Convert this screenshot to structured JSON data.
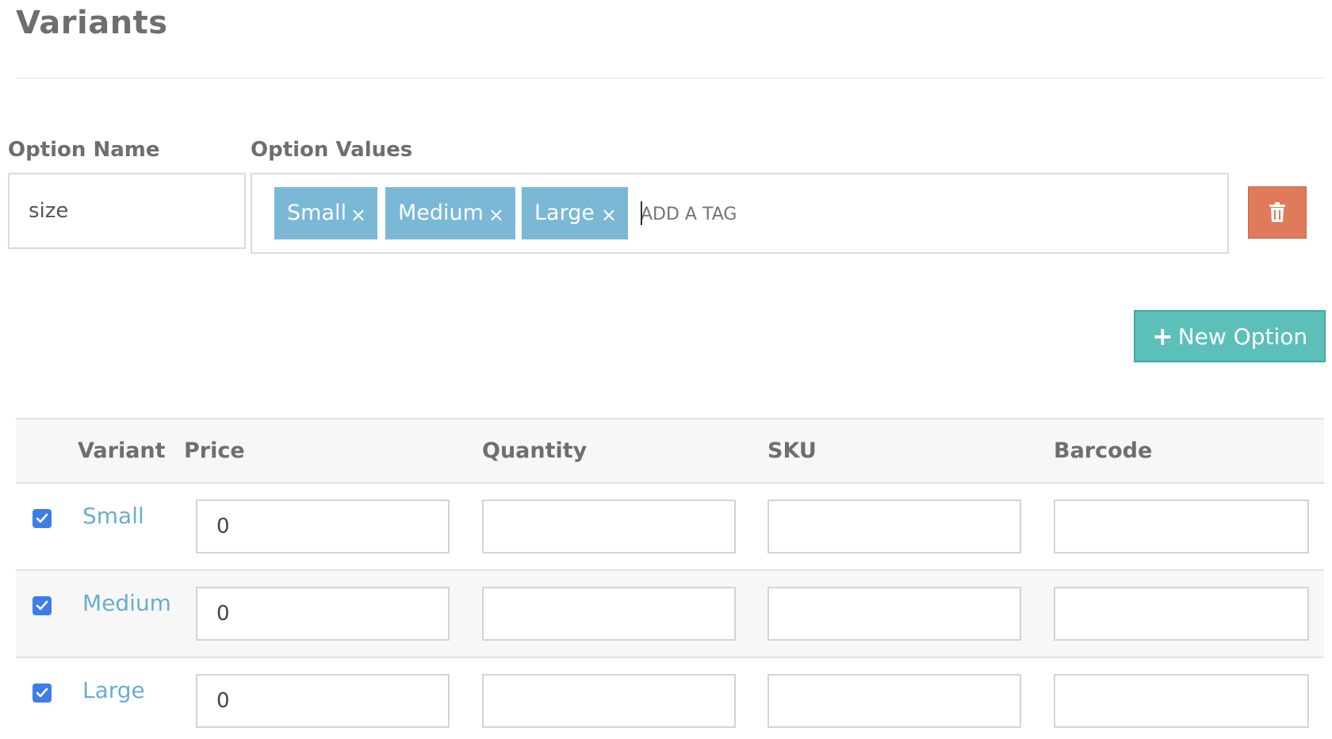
{
  "page": {
    "title": "Variants"
  },
  "option": {
    "name_label": "Option Name",
    "name_value": "size",
    "values_label": "Option Values",
    "tags": [
      {
        "label": "Small",
        "remove": "×"
      },
      {
        "label": "Medium",
        "remove": "×"
      },
      {
        "label": "Large",
        "remove": "×"
      }
    ],
    "tag_placeholder": "ADD A TAG",
    "delete_icon": "trash-icon"
  },
  "new_option": {
    "icon": "plus-icon",
    "icon_glyph": "+",
    "label": "New Option"
  },
  "table": {
    "headers": [
      "",
      "Variant",
      "Price",
      "Quantity",
      "SKU",
      "Barcode"
    ],
    "rows": [
      {
        "checked": true,
        "variant": "Small",
        "price": "0",
        "quantity": "",
        "sku": "",
        "barcode": ""
      },
      {
        "checked": true,
        "variant": "Medium",
        "price": "0",
        "quantity": "",
        "sku": "",
        "barcode": ""
      },
      {
        "checked": true,
        "variant": "Large",
        "price": "0",
        "quantity": "",
        "sku": "",
        "barcode": ""
      }
    ]
  },
  "colors": {
    "tag_bg": "#7ab8d6",
    "delete_bg": "#df7a5a",
    "new_option_bg": "#5cbfba",
    "variant_link": "#69aed0",
    "checkbox": "#3d7ee6"
  }
}
